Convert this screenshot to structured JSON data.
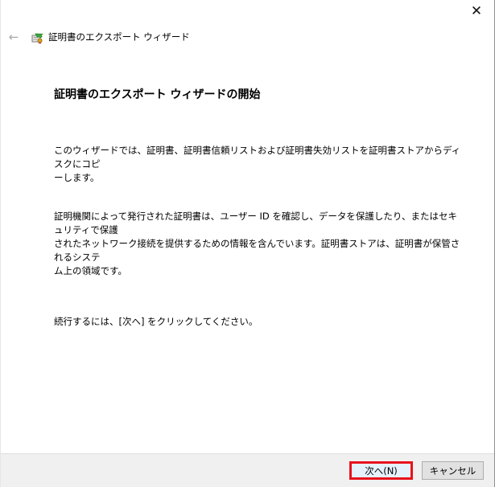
{
  "window": {
    "close_glyph": "✕"
  },
  "header": {
    "back_glyph": "←",
    "wizard_title": "証明書のエクスポート ウィザード"
  },
  "main": {
    "page_title": "証明書のエクスポート ウィザードの開始",
    "paragraph_1_line_1": "このウィザードでは、証明書、証明書信頼リストおよび証明書失効リストを証明書ストアからディスクにコピ",
    "paragraph_1_line_2": "ーします。",
    "paragraph_2_line_1": "証明機関によって発行された証明書は、ユーザー ID を確認し、データを保護したり、またはセキュリティで保護",
    "paragraph_2_line_2": "されたネットワーク接続を提供するための情報を含んでいます。証明書ストアは、証明書が保管されるシステ",
    "paragraph_2_line_3": "ム上の領域です。",
    "paragraph_3": "続行するには、[次へ] をクリックしてください。"
  },
  "footer": {
    "next_label": "次へ(N)",
    "cancel_label": "キャンセル"
  },
  "colors": {
    "highlight_border": "#e8121c",
    "footer_bg": "#f0f0f0",
    "button_bg": "#e1e1e1"
  },
  "icons": {
    "back": "arrow-left-icon",
    "wizard": "certificate-icon",
    "close": "close-icon"
  }
}
